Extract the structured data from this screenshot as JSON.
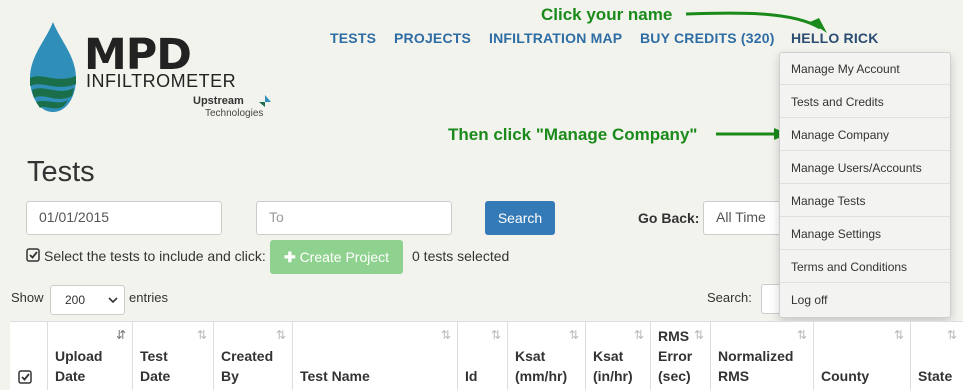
{
  "logo": {
    "mpd": "MPD",
    "infiltrometer": "INFILTROMETER",
    "upstream": "Upstream",
    "technologies": "Technologies"
  },
  "nav": {
    "tests": "TESTS",
    "projects": "PROJECTS",
    "infiltration_map": "INFILTRATION MAP",
    "buy_credits": "BUY CREDITS (320)",
    "hello": "HELLO RICK"
  },
  "annotations": {
    "click_name": "Click your name",
    "then_click": "Then click \"Manage Company\""
  },
  "dropdown": {
    "items": [
      "Manage My Account",
      "Tests and Credits",
      "Manage Company",
      "Manage Users/Accounts",
      "Manage Tests",
      "Manage Settings",
      "Terms and Conditions",
      "Log off"
    ]
  },
  "page": {
    "title": "Tests",
    "date_from": "01/01/2015",
    "date_to_placeholder": "To",
    "search_button": "Search",
    "go_back_label": "Go Back:",
    "go_back_value": "All Time",
    "select_text": "Select the tests to include and click:",
    "create_project": "Create Project",
    "tests_selected": "0 tests selected",
    "show": "Show",
    "entries_value": "200",
    "entries": "entries",
    "search_label": "Search:"
  },
  "table": {
    "columns": [
      {
        "label": ""
      },
      {
        "label": "Upload\nDate"
      },
      {
        "label": "Test\nDate"
      },
      {
        "label": "Created\nBy"
      },
      {
        "label": "Test Name"
      },
      {
        "label": "Id"
      },
      {
        "label": "Ksat\n(mm/hr)"
      },
      {
        "label": "Ksat\n(in/hr)"
      },
      {
        "label": "RMS\nError\n(sec)"
      },
      {
        "label": "Normalized\nRMS"
      },
      {
        "label": "County"
      },
      {
        "label": "State"
      }
    ]
  },
  "colors": {
    "nav": "#2e6da4",
    "annotation": "#1a8a1a",
    "primary": "#337ab7",
    "create": "#8fd28f"
  }
}
